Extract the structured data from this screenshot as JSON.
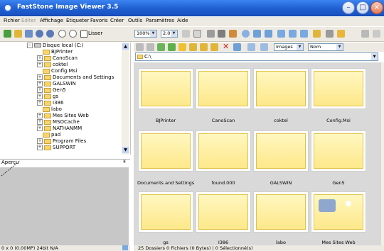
{
  "window": {
    "title": "FastStone Image Viewer 3.5"
  },
  "menu": [
    "Fichier",
    "Editer",
    "Affichage",
    "Etiqueter",
    "Favoris",
    "Créer",
    "Outils",
    "Paramètres",
    "Aide"
  ],
  "toolbar": {
    "lisser_label": "Lisser",
    "zoom": "100%",
    "ratio": "2.0",
    "view_mode": "Images",
    "sort": "Nom"
  },
  "tree": {
    "drive": "Disque local (C:)",
    "items": [
      "BJPrinter",
      "CanoScan",
      "coktel",
      "Config.Msi",
      "Documents and Settings",
      "GALSWIN",
      "Gen5",
      "gs",
      "I386",
      "labo",
      "Mes Sites Web",
      "MSOCache",
      "NATHANMM",
      "pad",
      "Program Files",
      "SUPPORT"
    ]
  },
  "preview": {
    "header": "Aperçu"
  },
  "path": {
    "value": "C:\\"
  },
  "thumbnails": [
    "BJPrinter",
    "CanoScan",
    "coktel",
    "Config.Msi",
    "Documents and Settings",
    "found.000",
    "GALSWIN",
    "Gen5",
    "gs",
    "I386",
    "labo",
    "Mes Sites Web"
  ],
  "status": {
    "left": "0 x 0 (0.00MP)  24bit N/A",
    "right": "25 Dossiers  0 Fichiers (0 Bytes)  |  0 Sélectionné(s)"
  }
}
